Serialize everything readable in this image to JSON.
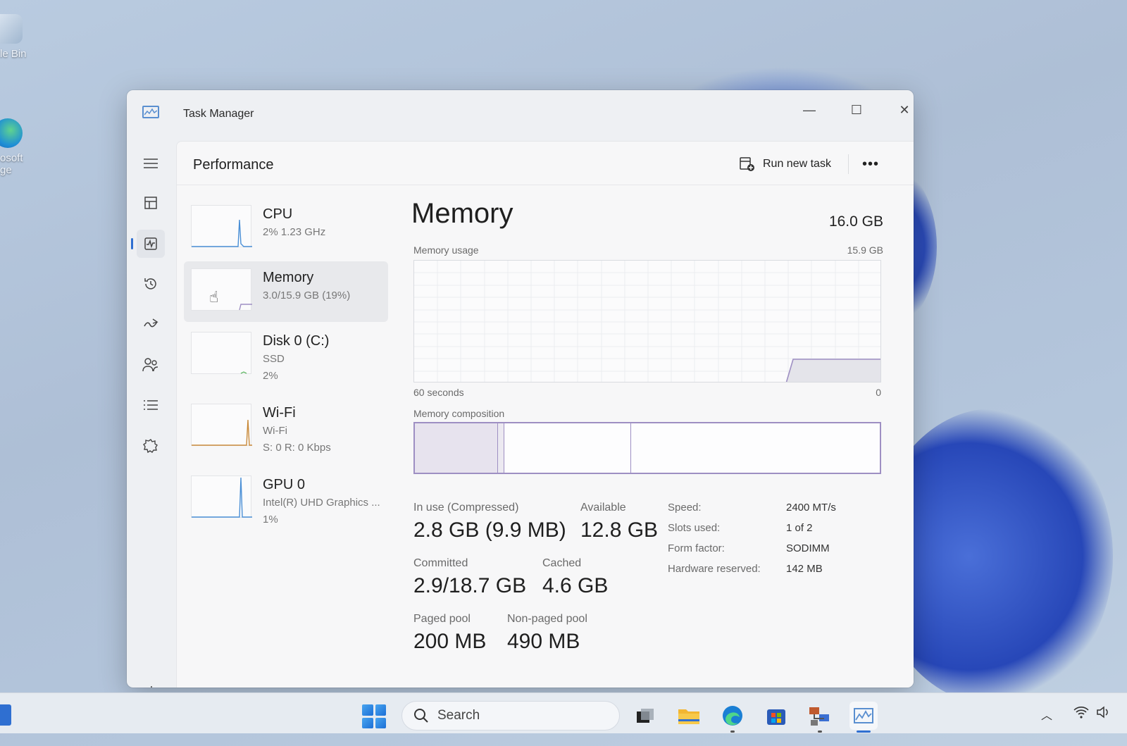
{
  "desktop": {
    "icons": [
      {
        "label": "le Bin"
      },
      {
        "label": "osoft\nge"
      }
    ]
  },
  "window": {
    "title": "Task Manager",
    "minimize_glyph": "—",
    "maximize_glyph": "☐",
    "close_glyph": "✕"
  },
  "header": {
    "page_title": "Performance",
    "run_new_task": "Run new task",
    "more_glyph": "•••"
  },
  "resources": [
    {
      "name": "CPU",
      "sub1": "2%  1.23 GHz",
      "sub2": "",
      "sub3": ""
    },
    {
      "name": "Memory",
      "sub1": "3.0/15.9 GB (19%)",
      "sub2": "",
      "sub3": ""
    },
    {
      "name": "Disk 0 (C:)",
      "sub1": "SSD",
      "sub2": "2%",
      "sub3": ""
    },
    {
      "name": "Wi-Fi",
      "sub1": "Wi-Fi",
      "sub2": "S: 0  R: 0 Kbps",
      "sub3": ""
    },
    {
      "name": "GPU 0",
      "sub1": "Intel(R) UHD Graphics ...",
      "sub2": "1%",
      "sub3": ""
    }
  ],
  "memory": {
    "title": "Memory",
    "total": "16.0 GB",
    "usage_label": "Memory usage",
    "usage_max": "15.9 GB",
    "axis_left": "60 seconds",
    "axis_right": "0",
    "composition_label": "Memory composition",
    "in_use_label": "In use (Compressed)",
    "in_use_value": "2.8 GB (9.9 MB)",
    "available_label": "Available",
    "available_value": "12.8 GB",
    "committed_label": "Committed",
    "committed_value": "2.9/18.7 GB",
    "cached_label": "Cached",
    "cached_value": "4.6 GB",
    "paged_label": "Paged pool",
    "paged_value": "200 MB",
    "nonpaged_label": "Non-paged pool",
    "nonpaged_value": "490 MB",
    "specs": [
      {
        "label": "Speed:",
        "value": "2400 MT/s"
      },
      {
        "label": "Slots used:",
        "value": "1 of 2"
      },
      {
        "label": "Form factor:",
        "value": "SODIMM"
      },
      {
        "label": "Hardware reserved:",
        "value": "142 MB"
      }
    ]
  },
  "taskbar": {
    "search_label": "Search"
  },
  "colors": {
    "accent": "#2f6fd1",
    "memory_line": "#9e8fc3",
    "cpu_line": "#4a8fd6",
    "wifi_line": "#c98a3a"
  }
}
